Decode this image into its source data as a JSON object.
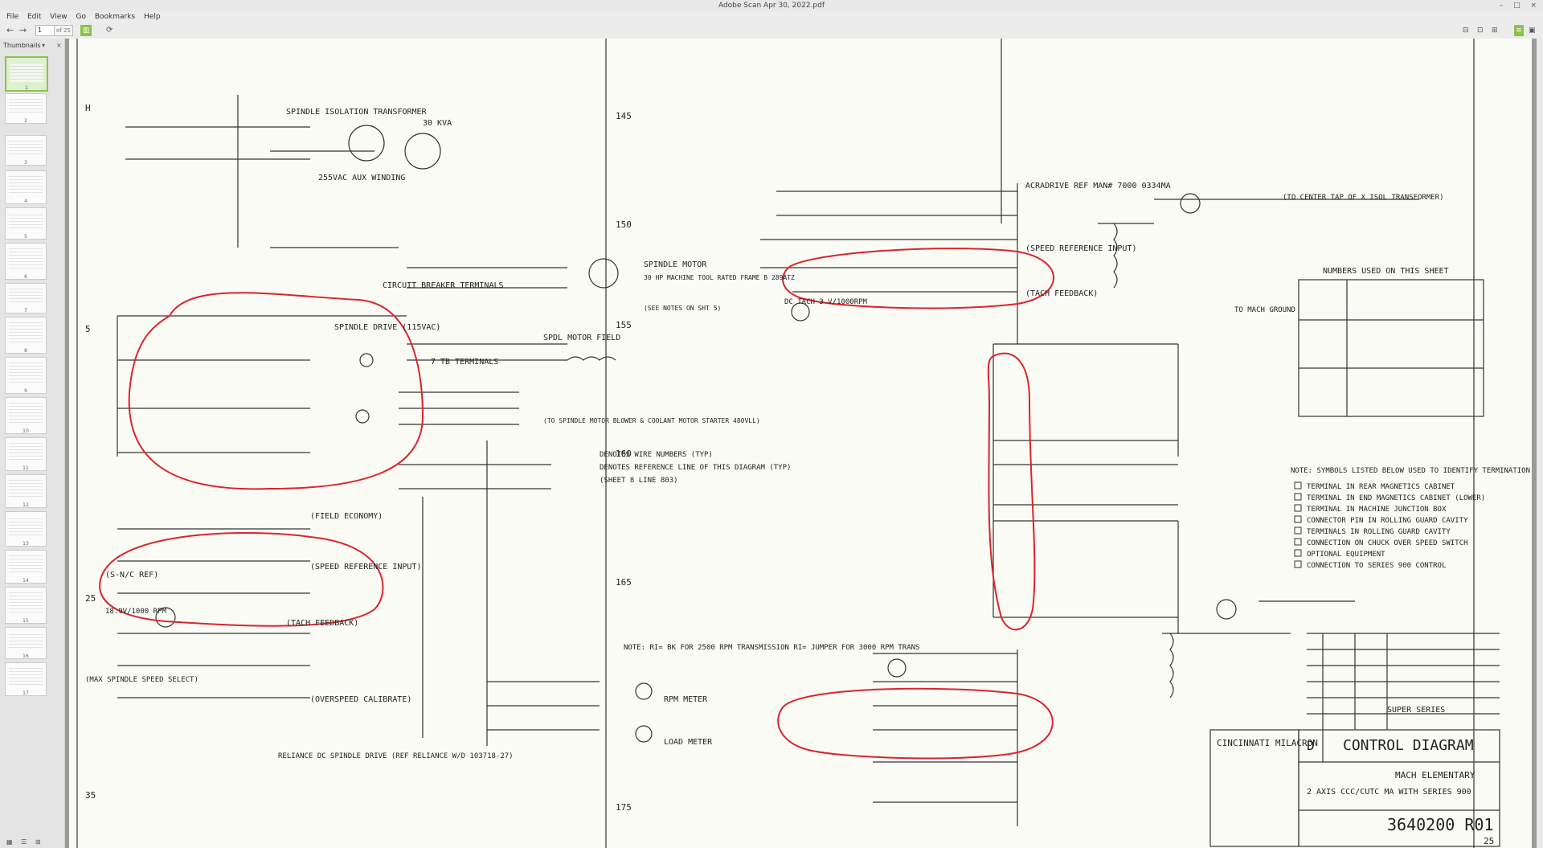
{
  "window": {
    "title": "Adobe Scan Apr 30, 2022.pdf"
  },
  "menu": [
    "File",
    "Edit",
    "View",
    "Go",
    "Bookmarks",
    "Help"
  ],
  "toolbar": {
    "page_value": "1",
    "page_total": "of 25"
  },
  "sidebar": {
    "mode_label": "Thumbnails",
    "thumbnails": [
      "1",
      "2",
      "3",
      "4",
      "5",
      "6",
      "7",
      "8",
      "9",
      "10",
      "11",
      "12",
      "13",
      "14",
      "15",
      "16",
      "17"
    ]
  },
  "diagram": {
    "left_title": "SPINDLE ISOLATION TRANSFORMER",
    "kva": "30 KVA",
    "aux": "255VAC AUX WINDING",
    "cb": "CIRCUIT BREAKER TERMINALS",
    "tb7": "7 TB TERMINALS",
    "spindle_drive": "SPINDLE DRIVE (115VAC)",
    "motor": "SPINDLE MOTOR",
    "motor2": "30 HP MACHINE TOOL RATED FRAME B 289ATZ",
    "notes_ref": "(SEE NOTES ON SHT 5)",
    "field": "SPDL MOTOR FIELD",
    "blower": "(TO SPINDLE MOTOR BLOWER & COOLANT MOTOR STARTER 480VLL)",
    "denotes1": "DENOTES WIRE NUMBERS (TYP)",
    "denotes2": "DENOTES REFERENCE LINE OF THIS DIAGRAM (TYP)",
    "denotes3": "(SHEET 8 LINE 803)",
    "field_econ": "(FIELD ECONOMY)",
    "speed_ref": "(SPEED REFERENCE INPUT)",
    "nc_ref": "(S-N/C REF)",
    "tach_fb": "(TACH FEEDBACK)",
    "rpm_label": "18.9V/1000 RPM",
    "overspeed": "(OVERSPEED CALIBRATE)",
    "max_spindle": "(MAX SPINDLE SPEED SELECT)",
    "reliance": "RELIANCE DC SPINDLE DRIVE (REF RELIANCE W/D 103718-27)",
    "note_ri": "NOTE: RI= BK FOR 2500 RPM TRANSMISSION RI= JUMPER FOR 3000 RPM TRANS",
    "rpm_meter": "RPM METER",
    "load_meter": "LOAD METER",
    "acradrive": "ACRADRIVE REF MAN# 7000 0334MA",
    "speed_ref_r": "(SPEED REFERENCE INPUT)",
    "tach_fb_r": "(TACH FEEDBACK)",
    "dc_tach": "DC TACH 3 V/1000RPM",
    "to_mach": "TO MACH GROUND",
    "to_center": "(TO CENTER TAP OF X ISOL TRANSFORMER)",
    "numbers_title": "NUMBERS USED ON THIS SHEET",
    "note_symbols": "NOTE: SYMBOLS LISTED BELOW USED TO IDENTIFY TERMINATION POINTS.",
    "legend": [
      "TERMINAL IN REAR MAGNETICS CABINET",
      "TERMINAL IN END MAGNETICS CABINET (LOWER)",
      "TERMINAL IN MACHINE JUNCTION BOX",
      "CONNECTOR PIN IN ROLLING GUARD CAVITY",
      "TERMINALS IN ROLLING GUARD CAVITY",
      "CONNECTION ON CHUCK OVER SPEED SWITCH",
      "OPTIONAL EQUIPMENT",
      "CONNECTION TO SERIES 900 CONTROL"
    ],
    "title_block": {
      "size": "D",
      "title": "CONTROL DIAGRAM",
      "company": "CINCINNATI MILACRON",
      "sub1": "MACH ELEMENTARY",
      "sub2": "2 AXIS CCC/CUTC MA WITH SERIES 900",
      "dwg": "3640200 R01",
      "sheet": "25",
      "series": "SUPER SERIES"
    }
  }
}
